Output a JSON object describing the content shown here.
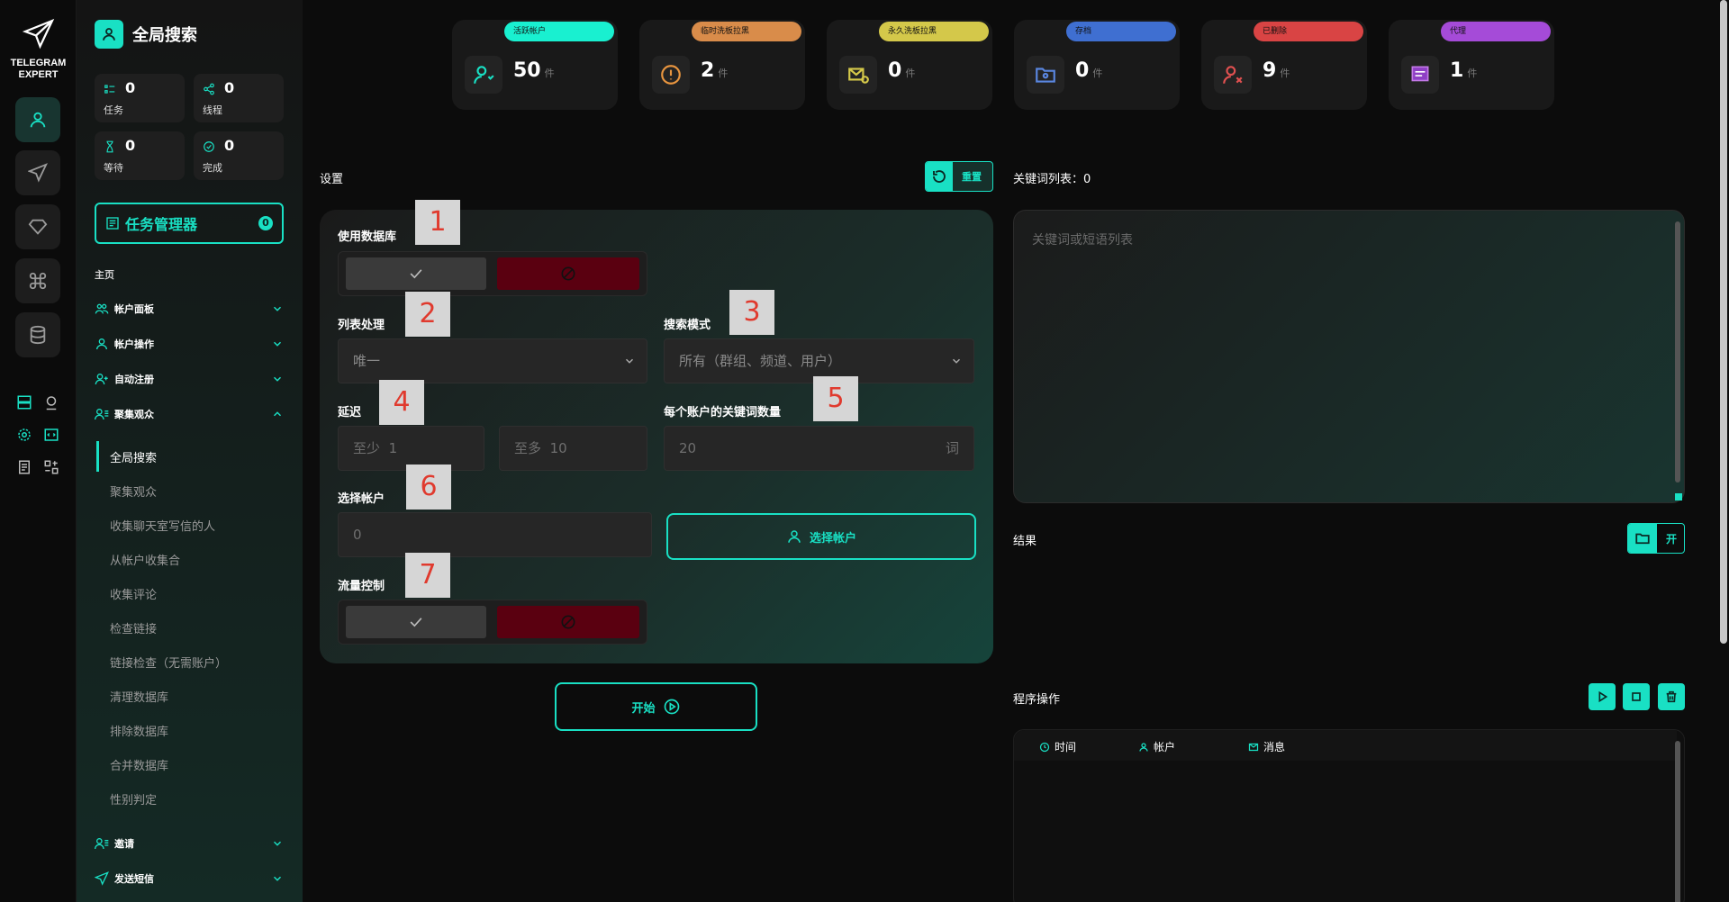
{
  "brand": {
    "line1": "TELEGRAM",
    "line2": "EXPERT"
  },
  "sidebar": {
    "title": "全局搜索",
    "stats": [
      {
        "value": "0",
        "label": "任务",
        "icon": "list-icon"
      },
      {
        "value": "0",
        "label": "线程",
        "icon": "share-icon"
      },
      {
        "value": "0",
        "label": "等待",
        "icon": "hourglass-icon"
      },
      {
        "value": "0",
        "label": "完成",
        "icon": "check-circle-icon"
      }
    ],
    "task_manager": {
      "label": "任务管理器",
      "badge": "0"
    },
    "section_label": "主页",
    "groups": [
      {
        "label": "帐户面板",
        "icon": "users-icon",
        "expanded": false
      },
      {
        "label": "帐户操作",
        "icon": "user-icon",
        "expanded": false
      },
      {
        "label": "自动注册",
        "icon": "user-plus-icon",
        "expanded": false
      },
      {
        "label": "聚集观众",
        "icon": "user-list-icon",
        "expanded": true
      },
      {
        "label": "邀请",
        "icon": "user-list-icon",
        "expanded": false
      },
      {
        "label": "发送短信",
        "icon": "send-icon",
        "expanded": false
      }
    ],
    "sub_items": [
      "全局搜索",
      "聚集观众",
      "收集聊天室写信的人",
      "从帐户收集合",
      "收集评论",
      "检查链接",
      "链接检查（无需账户）",
      "清理数据库",
      "排除数据库",
      "合并数据库",
      "性别判定"
    ],
    "active_sub": 0
  },
  "cards": [
    {
      "label": "活跃帐户",
      "value": "50",
      "unit": "件",
      "color": "#19f0d0",
      "icon": "user-heart-icon"
    },
    {
      "label": "临时洗板拉黑",
      "value": "2",
      "unit": "件",
      "color": "#d98c4a",
      "icon": "warning-circle-icon"
    },
    {
      "label": "永久洗板拉黑",
      "value": "0",
      "unit": "件",
      "color": "#d4c84a",
      "icon": "mail-block-icon"
    },
    {
      "label": "存档",
      "value": "0",
      "unit": "件",
      "color": "#3f6fd1",
      "icon": "folder-user-icon"
    },
    {
      "label": "已删除",
      "value": "9",
      "unit": "件",
      "color": "#d94444",
      "icon": "user-x-icon"
    },
    {
      "label": "代理",
      "value": "1",
      "unit": "件",
      "color": "#a54bd8",
      "icon": "proxy-icon"
    }
  ],
  "settings": {
    "title": "设置",
    "reset_label": "重置",
    "use_db": "使用数据库",
    "list_proc": "列表处理",
    "list_proc_value": "唯一",
    "search_mode": "搜索模式",
    "search_mode_value": "所有（群组、频道、用户）",
    "delay": "延迟",
    "delay_min_prefix": "至少",
    "delay_min": "1",
    "delay_max_prefix": "至多",
    "delay_max": "10",
    "kw_per_acc": "每个账户的关键词数量",
    "kw_per_acc_value": "20",
    "kw_per_acc_unit": "词",
    "select_acc": "选择帐户",
    "select_acc_value": "0",
    "select_acc_button": "选择帐户",
    "flow_control": "流量控制",
    "start": "开始"
  },
  "tags": [
    "1",
    "2",
    "3",
    "4",
    "5",
    "6",
    "7"
  ],
  "keywords": {
    "title": "关键词列表：0",
    "placeholder": "关键词或短语列表"
  },
  "results": {
    "title": "结果",
    "button": "开"
  },
  "program": {
    "title": "程序操作",
    "cols": [
      "时间",
      "帐户",
      "消息"
    ]
  },
  "accent": "#19e0c4"
}
